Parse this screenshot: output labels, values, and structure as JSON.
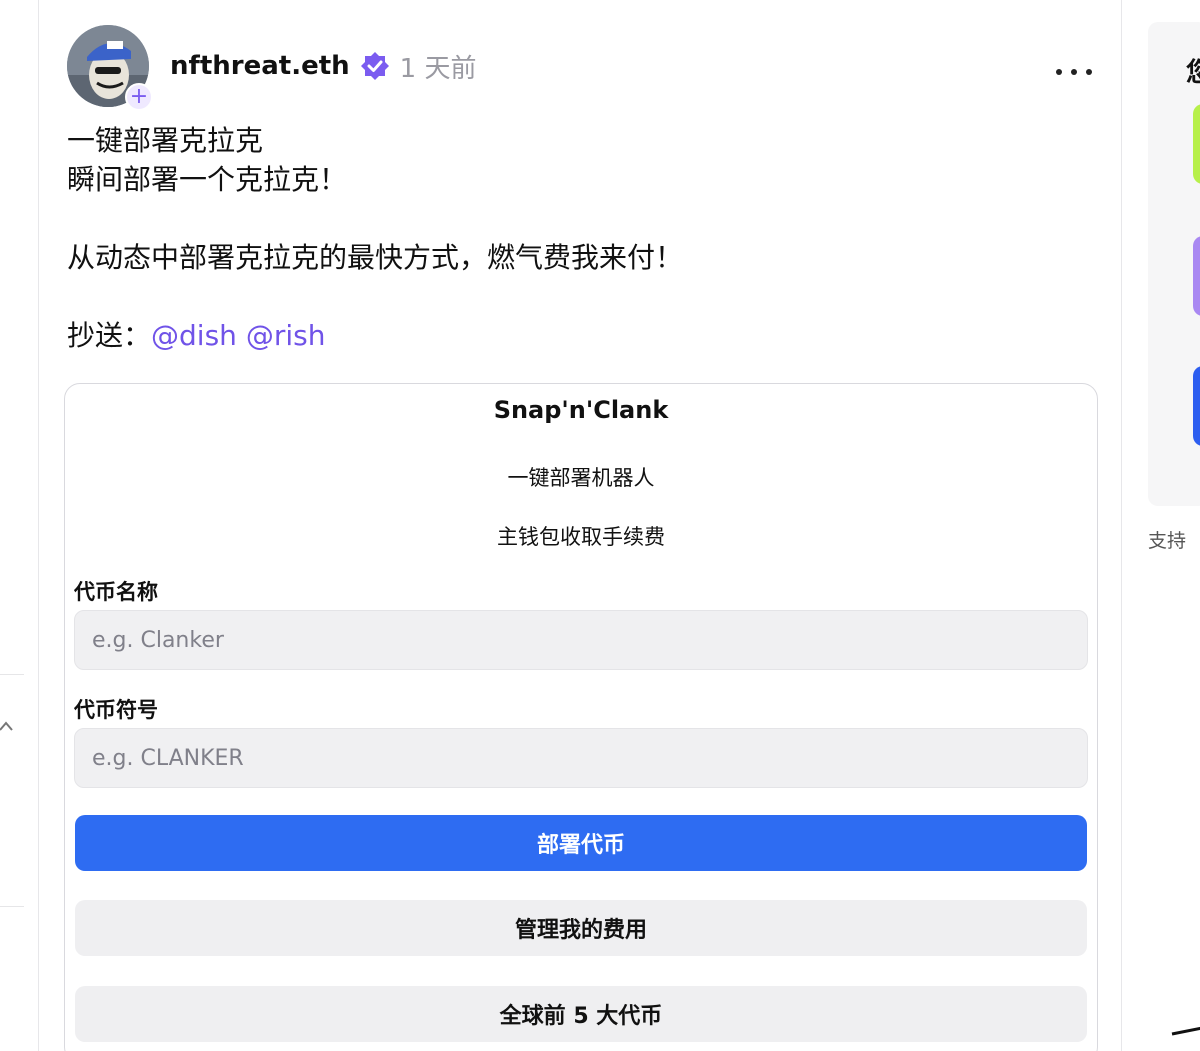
{
  "post": {
    "author": "nfthreat.eth",
    "time": "1 天前",
    "lines": [
      "一键部署克拉克",
      "瞬间部署一个克拉克！",
      "从动态中部署克拉克的最快方式，燃气费我来付！"
    ],
    "cc_label": "抄送：",
    "mentions": [
      "@dish",
      "@rish"
    ]
  },
  "frame": {
    "title": "Snap'n'Clank",
    "subtitle_1": "一键部署机器人",
    "subtitle_2": "主钱包收取手续费",
    "token_name_label": "代币名称",
    "token_name_placeholder": "e.g. Clanker",
    "token_symbol_label": "代币符号",
    "token_symbol_placeholder": "e.g. CLANKER",
    "deploy_button": "部署代币",
    "manage_fees_button": "管理我的费用",
    "top5_button": "全球前 5 大代币"
  },
  "right_rail": {
    "title_partial": "您",
    "support_partial": "支持",
    "swatches": [
      "#b7f04a",
      "#a988f2",
      "#2d5ef0"
    ]
  },
  "colors": {
    "accent": "#2e6cf2",
    "mention": "#7053e8",
    "verified": "#7b5cf0"
  },
  "icons": [
    "avatar",
    "plus-icon",
    "verified-badge-icon",
    "more-icon",
    "chevron-up-icon"
  ]
}
